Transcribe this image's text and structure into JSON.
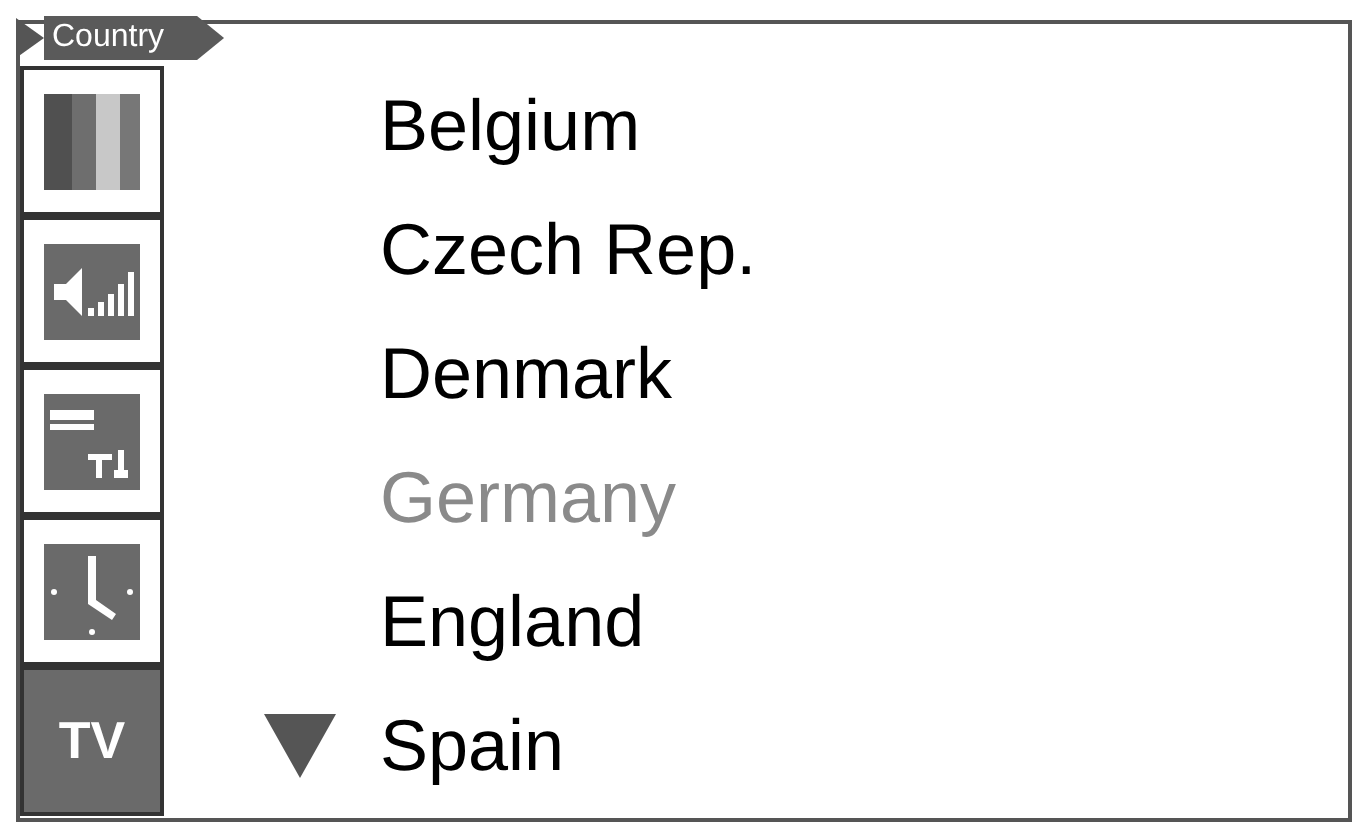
{
  "menu_title": "Country",
  "sidebar": [
    {
      "kind": "picture",
      "selected": false
    },
    {
      "kind": "sound",
      "selected": false
    },
    {
      "kind": "setup",
      "selected": false
    },
    {
      "kind": "clock",
      "selected": false
    },
    {
      "kind": "tv",
      "label": "TV",
      "selected": true
    }
  ],
  "countries": [
    {
      "name": "Belgium",
      "selected": false
    },
    {
      "name": "Czech Rep.",
      "selected": false
    },
    {
      "name": "Denmark",
      "selected": false
    },
    {
      "name": "Germany",
      "selected": true
    },
    {
      "name": "England",
      "selected": false
    },
    {
      "name": "Spain",
      "selected": false,
      "more_below": true
    }
  ]
}
